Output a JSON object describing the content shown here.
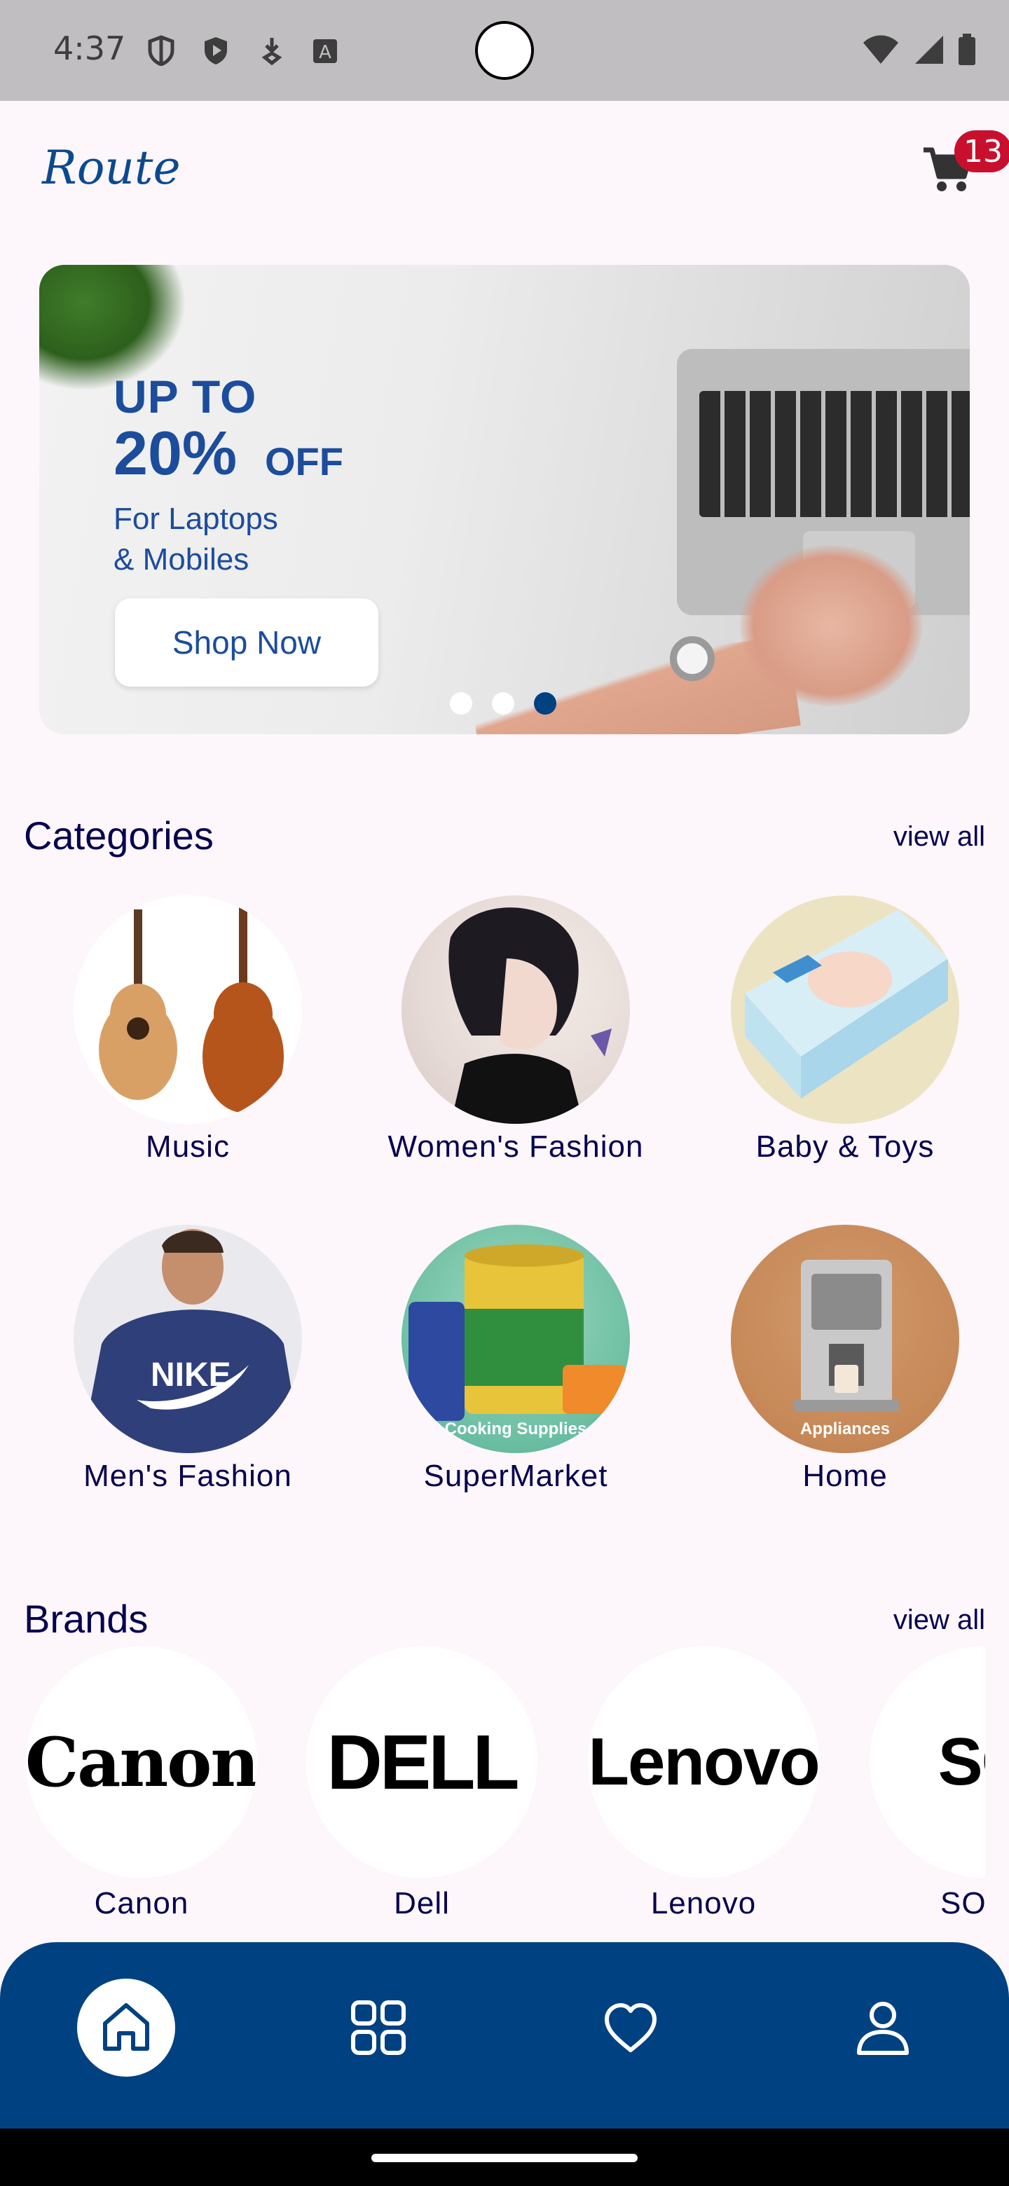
{
  "status_bar": {
    "time": "4:37",
    "icons": [
      "shield-icon",
      "play-protect-icon",
      "download-icon",
      "a-icon",
      "wifi-icon",
      "signal-icon",
      "battery-icon"
    ]
  },
  "header": {
    "logo_text": "Route",
    "cart_badge": "13"
  },
  "banner": {
    "line1": "UP TO",
    "percent": "20%",
    "off": "OFF",
    "subtitle1": "For Laptops",
    "subtitle2": "& Mobiles",
    "button": "Shop Now",
    "dots_count": 3,
    "active_dot": 3
  },
  "categories": {
    "title": "Categories",
    "view_all": "view all",
    "items": [
      {
        "label": "Music"
      },
      {
        "label": "Women's Fashion"
      },
      {
        "label": "Baby & Toys"
      },
      {
        "label": "Men's Fashion"
      },
      {
        "label": "SuperMarket",
        "caption": "Cooking Supplies"
      },
      {
        "label": "Home",
        "caption": "Appliances"
      }
    ]
  },
  "brands": {
    "title": "Brands",
    "view_all": "view all",
    "items": [
      {
        "label": "Canon",
        "logo": "Canon"
      },
      {
        "label": "Dell",
        "logo": "DELL"
      },
      {
        "label": "Lenovo",
        "logo": "Lenovo"
      },
      {
        "label": "SO",
        "logo": "SO"
      }
    ]
  },
  "bottom_nav": {
    "items": [
      "home-icon",
      "categories-icon",
      "wishlist-icon",
      "profile-icon"
    ],
    "active": "home-icon"
  },
  "colors": {
    "primary": "#004182",
    "text": "#06004f",
    "background": "#fdf7fc",
    "badge": "#c8102e"
  }
}
